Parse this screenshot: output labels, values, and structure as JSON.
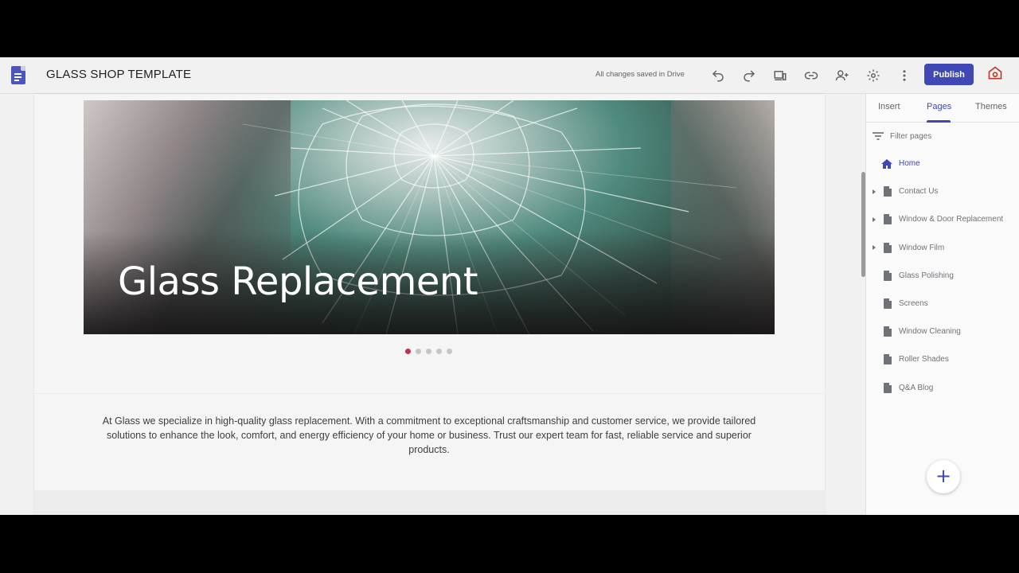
{
  "app": {
    "site_title": "GLASS SHOP TEMPLATE",
    "save_status": "All changes saved in Drive",
    "publish_label": "Publish",
    "accent_color": "#3f48b5",
    "icons": [
      "undo-icon",
      "redo-icon",
      "preview-devices-icon",
      "link-icon",
      "share-icon",
      "settings-icon",
      "more-vert-icon",
      "view-site-icon"
    ]
  },
  "hero": {
    "title": "Glass Replacement",
    "carousel_slides": 5,
    "active_slide": 1
  },
  "intro_text": "At Glass we specialize in high-quality glass replacement. With a commitment to exceptional craftsmanship and customer service, we provide tailored solutions to enhance the look, comfort, and energy efficiency of your home or business. Trust our expert team for fast, reliable service and superior products.",
  "panel": {
    "tabs": [
      {
        "label": "Insert"
      },
      {
        "label": "Pages",
        "active": true
      },
      {
        "label": "Themes"
      }
    ],
    "filter_placeholder": "Filter pages",
    "pages": [
      {
        "label": "Home",
        "home": true,
        "expandable": false
      },
      {
        "label": "Contact Us",
        "expandable": true
      },
      {
        "label": "Window & Door Replacement",
        "expandable": true
      },
      {
        "label": "Window Film",
        "expandable": true
      },
      {
        "label": "Glass Polishing",
        "expandable": false
      },
      {
        "label": "Screens",
        "expandable": false
      },
      {
        "label": "Window Cleaning",
        "expandable": false
      },
      {
        "label": "Roller Shades",
        "expandable": false
      },
      {
        "label": "Q&A Blog",
        "expandable": false
      }
    ],
    "fab_label": "+"
  }
}
